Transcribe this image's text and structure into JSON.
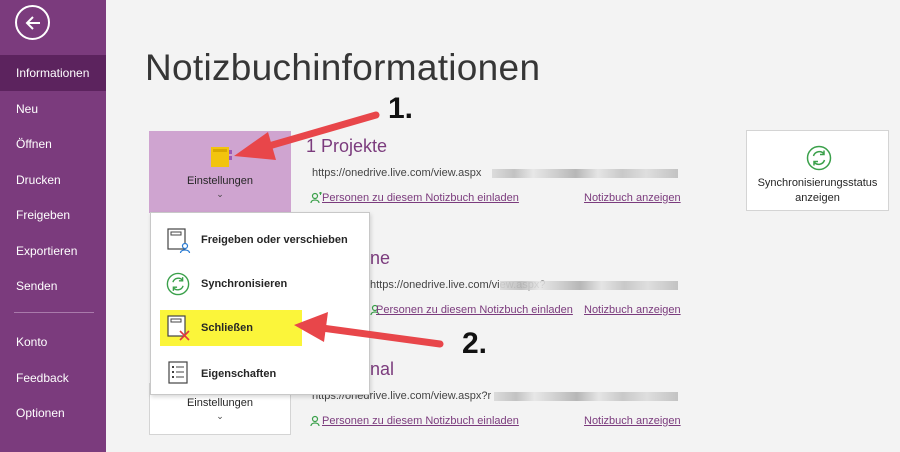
{
  "sidebar": {
    "items": [
      {
        "label": "Informationen",
        "active": true
      },
      {
        "label": "Neu"
      },
      {
        "label": "Öffnen"
      },
      {
        "label": "Drucken"
      },
      {
        "label": "Freigeben"
      },
      {
        "label": "Exportieren"
      },
      {
        "label": "Senden"
      },
      {
        "label": "Konto"
      },
      {
        "label": "Feedback"
      },
      {
        "label": "Optionen"
      }
    ]
  },
  "page": {
    "title": "Notizbuchinformationen"
  },
  "notebooks": [
    {
      "title": "1 Projekte",
      "url": "https://onedrive.live.com/view.aspx",
      "invite": "Personen zu diesem Notizbuch einladen",
      "view": "Notizbuch anzeigen"
    },
    {
      "title": "ne",
      "url": "https://onedrive.live.com/view.aspx?",
      "invite": "Personen zu diesem Notizbuch einladen",
      "view": "Notizbuch anzeigen"
    },
    {
      "title": "nal",
      "url": "https://onedrive.live.com/view.aspx?r",
      "invite": "Personen zu diesem Notizbuch einladen",
      "view": "Notizbuch anzeigen"
    }
  ],
  "settings_button": {
    "label": "Einstellungen",
    "chevron": "⌄"
  },
  "settings_button_bottom": {
    "label": "Einstellungen",
    "chevron": "⌄"
  },
  "sync_status": {
    "label_line1": "Synchronisierungsstatus",
    "label_line2": "anzeigen"
  },
  "menu": {
    "items": [
      {
        "label": "Freigeben oder verschieben",
        "icon": "share-move-icon"
      },
      {
        "label": "Synchronisieren",
        "icon": "sync-icon"
      },
      {
        "label": "Schließen",
        "icon": "close-notebook-icon",
        "highlighted": true
      },
      {
        "label": "Eigenschaften",
        "icon": "properties-icon"
      }
    ]
  },
  "callouts": {
    "first": "1.",
    "second": "2."
  },
  "colors": {
    "accent": "#7b3b7d",
    "selected": "#cfa4d0",
    "highlight": "#fbf53a",
    "arrow": "#e8464a",
    "sync": "#3aa04a"
  }
}
